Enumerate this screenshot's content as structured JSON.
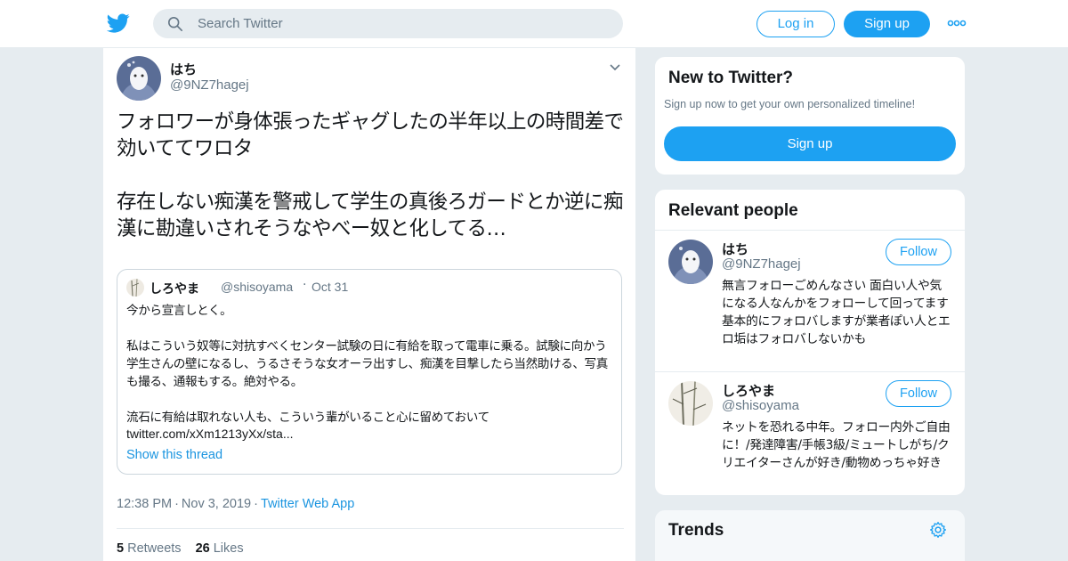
{
  "header": {
    "search_placeholder": "Search Twitter",
    "login_label": "Log in",
    "signup_label": "Sign up"
  },
  "tweet": {
    "author_name": "はち",
    "author_handle": "@9NZ7hagej",
    "text": "フォロワーが身体張ったギャグしたの半年以上の時間差で効いててワロタ\n\n存在しない痴漢を警戒して学生の真後ろガードとか逆に痴漢に勘違いされそうなやべー奴と化してる…",
    "quote": {
      "name": "しろやま",
      "handle": "@shisoyama",
      "date": "Oct 31",
      "text": "今から宣言しとく。\n\n私はこういう奴等に対抗すべくセンター試験の日に有給を取って電車に乗る。試験に向かう学生さんの壁になるし、うるさそうな女オーラ出すし、痴漢を目撃したら当然助ける、写真も撮る、通報もする。絶対やる。\n\n流石に有給は取れない人も、こういう輩がいること心に留めておいて",
      "link": "twitter.com/xXm1213yXx/sta...",
      "show_thread": "Show this thread"
    },
    "time": "12:38 PM",
    "date": "Nov 3, 2019",
    "via": "Twitter Web App",
    "retweets": "5",
    "retweets_label": "Retweets",
    "likes": "26",
    "likes_label": "Likes"
  },
  "sidebar": {
    "new_title": "New to Twitter?",
    "new_subtitle": "Sign up now to get your own personalized timeline!",
    "signup_label": "Sign up",
    "people_title": "Relevant people",
    "people": [
      {
        "name": "はち",
        "handle": "@9NZ7hagej",
        "follow_label": "Follow",
        "bio": "無言フォローごめんなさい 面白い人や気になる人なんかをフォローして回ってます 基本的にフォロバしますが業者ぽい人とエロ垢はフォロバしないかも"
      },
      {
        "name": "しろやま",
        "handle": "@shisoyama",
        "follow_label": "Follow",
        "bio": "ネットを恐れる中年。フォロー内外ご自由に！/発達障害/手帳3級/ミュートしがち/クリエイターさんが好き/動物めっちゃ好き"
      }
    ],
    "trends_title": "Trends"
  },
  "colors": {
    "brand_blue": "#1da1f2",
    "link_blue": "#1b95e0",
    "muted_text": "#657786",
    "background": "#e6ecf0"
  },
  "icons": [
    "twitter-bird-icon",
    "search-icon",
    "more-icon",
    "chevron-down-icon",
    "gear-icon"
  ]
}
